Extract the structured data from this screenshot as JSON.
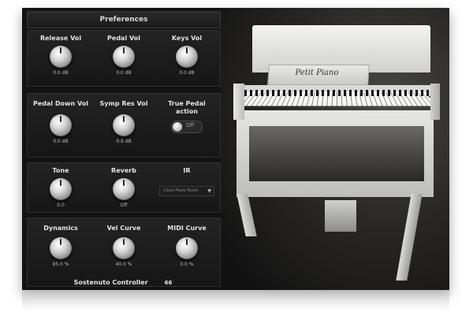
{
  "preferences": {
    "title": "Preferences",
    "row1": [
      {
        "label": "Release Vol",
        "value": "0.0 dB"
      },
      {
        "label": "Pedal Vol",
        "value": "0.0 dB"
      },
      {
        "label": "Keys Vol",
        "value": "0.0 dB"
      }
    ],
    "row2": [
      {
        "label": "Pedal Down Vol",
        "value": "0.0 dB"
      },
      {
        "label": "Symp Res Vol",
        "value": "0.9 dB"
      },
      {
        "label": "True Pedal action",
        "toggle": "Off"
      }
    ],
    "row3": [
      {
        "label": "Tone",
        "value": "0.0"
      },
      {
        "label": "Reverb",
        "value": "Off"
      },
      {
        "label": "IR",
        "dropdown": "Close Piano Room"
      }
    ],
    "row4": [
      {
        "label": "Dynamics",
        "value": "95.0 %"
      },
      {
        "label": "Vel Curve",
        "value": "40.0 %"
      },
      {
        "label": "MIDI Curve",
        "value": "0.0 %"
      }
    ],
    "sostenuto": {
      "label": "Sostenuto Controller",
      "value": "66"
    }
  },
  "piano": {
    "brand": "Petit Piano"
  },
  "icons": {
    "dropdown_arrow": "chevron-down-icon"
  }
}
